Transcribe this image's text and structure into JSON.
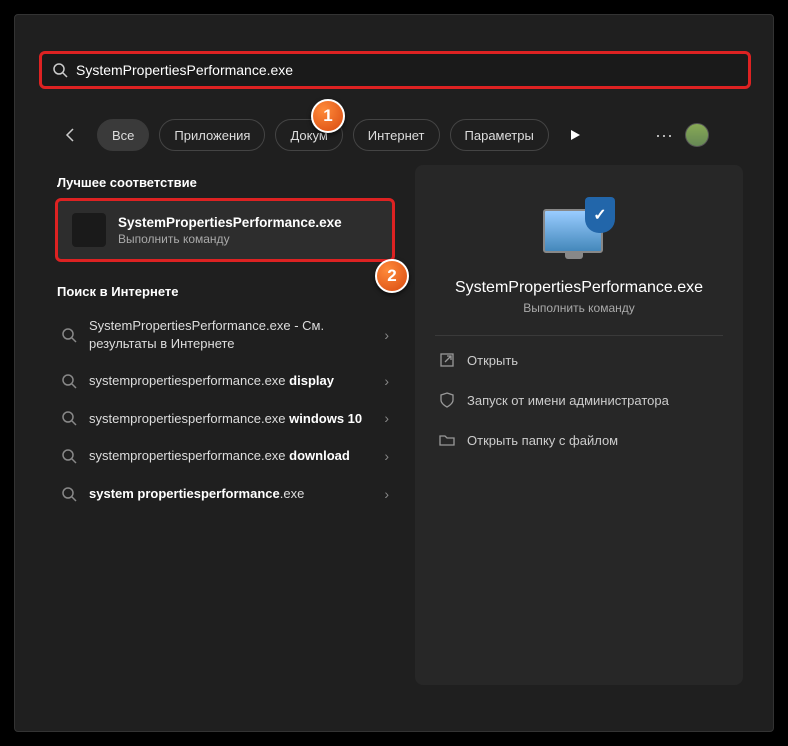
{
  "search": {
    "value": "SystemPropertiesPerformance.exe"
  },
  "tabs": {
    "all": "Все",
    "apps": "Приложения",
    "docs": "Докум",
    "internet": "Интернет",
    "settings": "Параметры"
  },
  "sections": {
    "best_match": "Лучшее соответствие",
    "web_search": "Поиск в Интернете"
  },
  "best": {
    "name": "SystemPropertiesPerformance.exe",
    "sub": "Выполнить команду"
  },
  "web": [
    {
      "pre": "SystemPropertiesPerformance.exe",
      "bold": "",
      "suf": " - См. результаты в Интернете"
    },
    {
      "pre": "systempropertiesperformance.exe ",
      "bold": "display",
      "suf": ""
    },
    {
      "pre": "systempropertiesperformance.exe ",
      "bold": "windows 10",
      "suf": ""
    },
    {
      "pre": "systempropertiesperformance.exe ",
      "bold": "download",
      "suf": ""
    },
    {
      "pre": "",
      "bold": "system propertiesperformance",
      "suf": ".exe"
    }
  ],
  "preview": {
    "title": "SystemPropertiesPerformance.exe",
    "sub": "Выполнить команду"
  },
  "actions": {
    "open": "Открыть",
    "admin": "Запуск от имени администратора",
    "folder": "Открыть папку с файлом"
  },
  "callouts": {
    "one": "1",
    "two": "2"
  },
  "colors": {
    "highlight": "#d22",
    "callout": "#e8571a"
  }
}
